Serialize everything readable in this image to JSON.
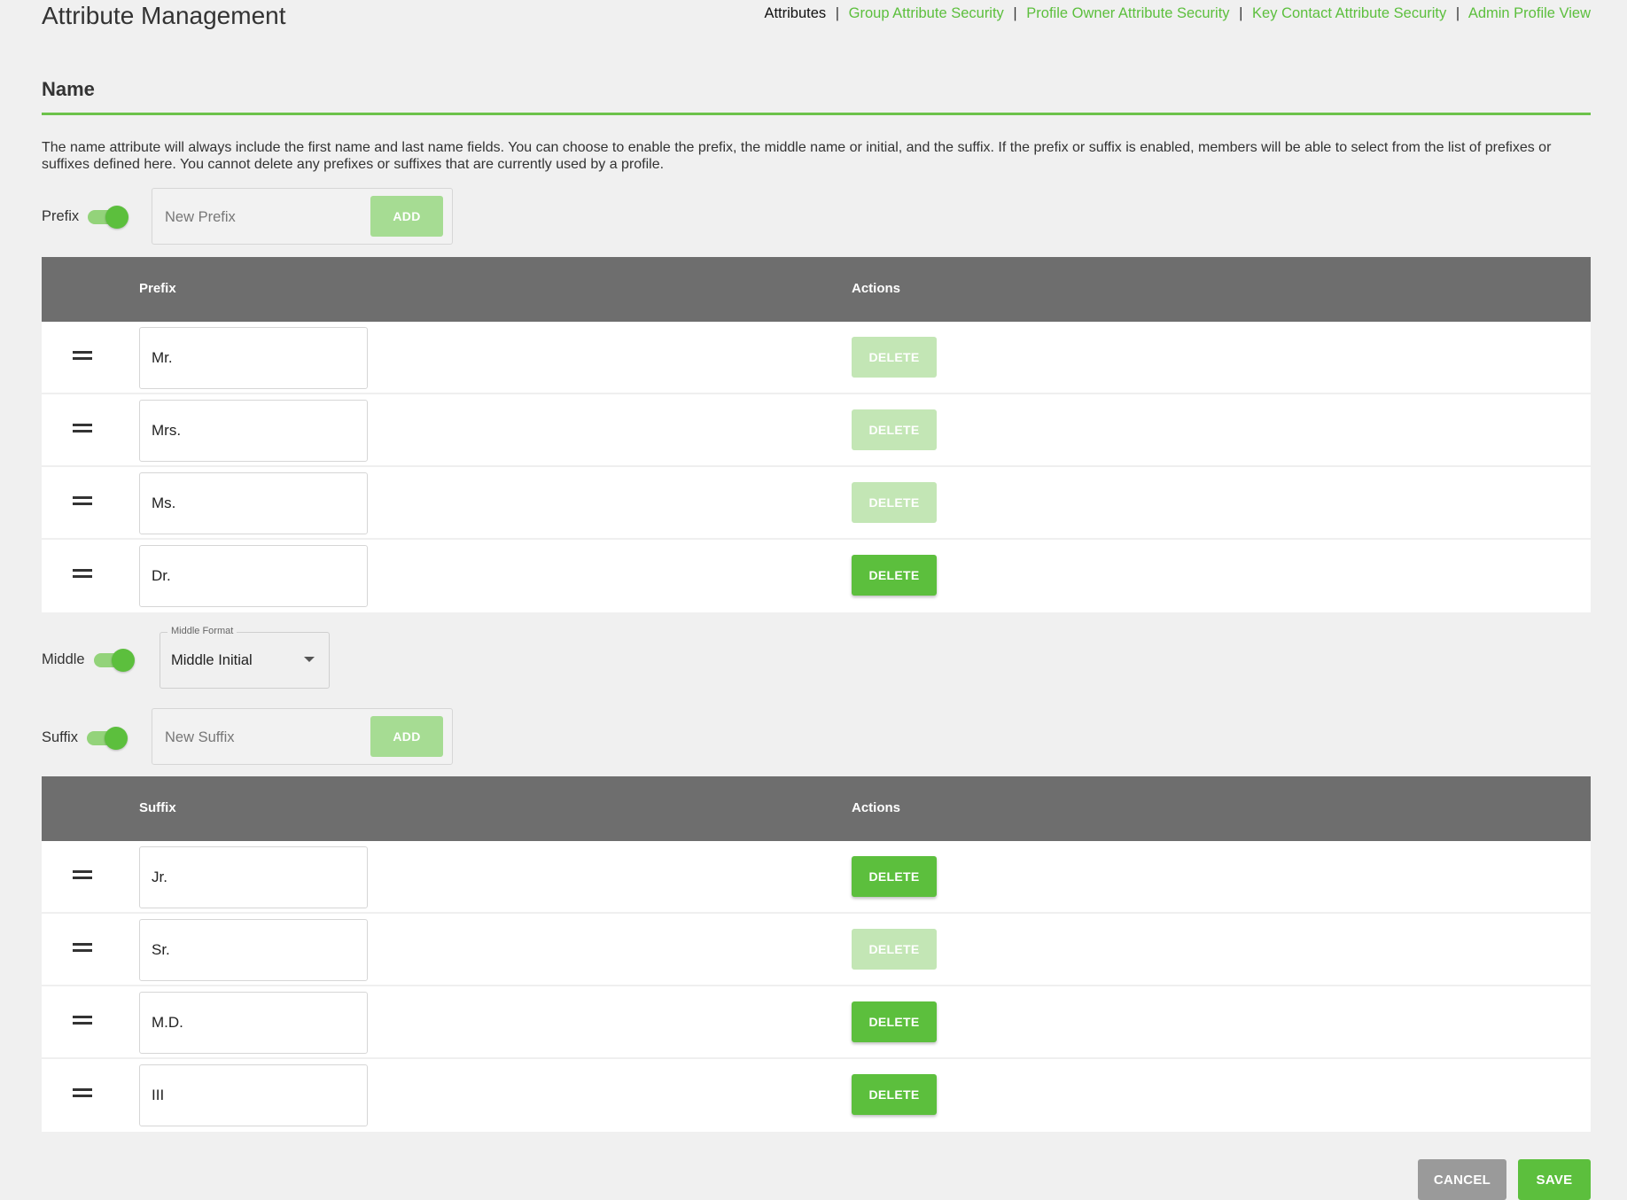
{
  "header": {
    "title": "Attribute Management",
    "nav": [
      {
        "label": "Attributes",
        "active": true
      },
      {
        "label": "Group Attribute Security",
        "active": false
      },
      {
        "label": "Profile Owner Attribute Security",
        "active": false
      },
      {
        "label": "Key Contact Attribute Security",
        "active": false
      },
      {
        "label": "Admin Profile View",
        "active": false
      }
    ],
    "separator": "|"
  },
  "section": {
    "title": "Name",
    "description": "The name attribute will always include the first name and last name fields. You can choose to enable the prefix, the middle name or initial, and the suffix. If the prefix or suffix is enabled, members will be able to select from the list of prefixes or suffixes defined here. You cannot delete any prefixes or suffixes that are currently used by a profile."
  },
  "prefix": {
    "toggle_label": "Prefix",
    "enabled": true,
    "input_placeholder": "New Prefix",
    "add_label": "ADD",
    "table": {
      "col_name": "Prefix",
      "col_actions": "Actions",
      "rows": [
        {
          "value": "Mr.",
          "delete_label": "DELETE",
          "delete_enabled": false
        },
        {
          "value": "Mrs.",
          "delete_label": "DELETE",
          "delete_enabled": false
        },
        {
          "value": "Ms.",
          "delete_label": "DELETE",
          "delete_enabled": false
        },
        {
          "value": "Dr.",
          "delete_label": "DELETE",
          "delete_enabled": true
        }
      ]
    }
  },
  "middle": {
    "toggle_label": "Middle",
    "enabled": true,
    "select_legend": "Middle Format",
    "select_value": "Middle Initial"
  },
  "suffix": {
    "toggle_label": "Suffix",
    "enabled": true,
    "input_placeholder": "New Suffix",
    "add_label": "ADD",
    "table": {
      "col_name": "Suffix",
      "col_actions": "Actions",
      "rows": [
        {
          "value": "Jr.",
          "delete_label": "DELETE",
          "delete_enabled": true
        },
        {
          "value": "Sr.",
          "delete_label": "DELETE",
          "delete_enabled": false
        },
        {
          "value": "M.D.",
          "delete_label": "DELETE",
          "delete_enabled": true
        },
        {
          "value": "III",
          "delete_label": "DELETE",
          "delete_enabled": true
        }
      ]
    }
  },
  "footer": {
    "cancel_label": "CANCEL",
    "save_label": "SAVE"
  },
  "colors": {
    "accent": "#5cbf3d",
    "accent_light": "#c3e6b5",
    "table_header": "#6e6e6e",
    "cancel": "#9a9a9a"
  }
}
